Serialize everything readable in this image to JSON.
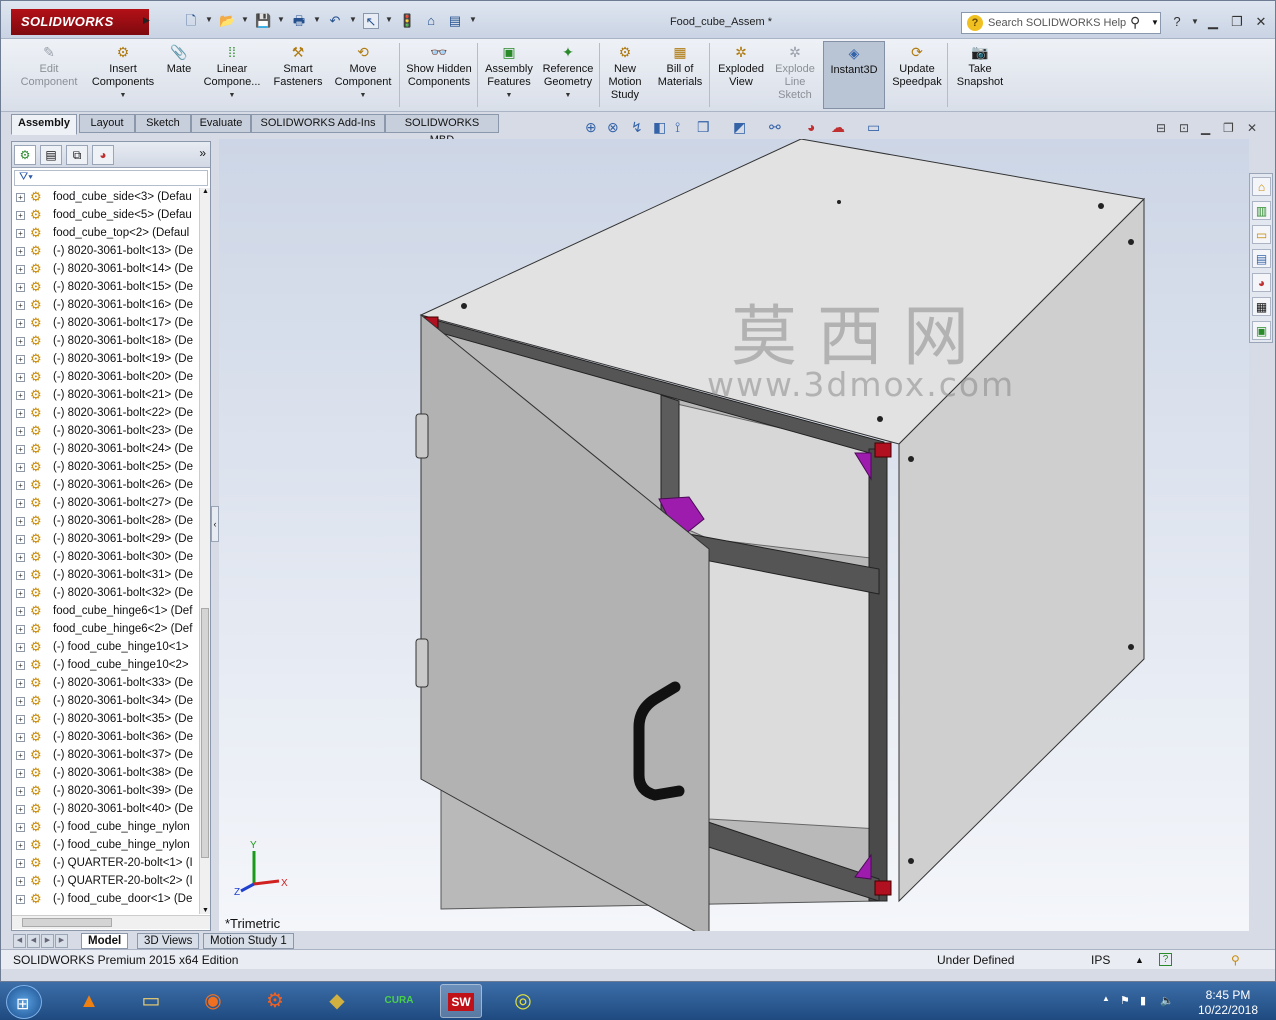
{
  "titlebar": {
    "app_logo": "SOLIDWORKS",
    "doc_title": "Food_cube_Assem *",
    "search_placeholder": "Search SOLIDWORKS Help",
    "quick_icons": [
      "new-icon",
      "open-icon",
      "save-icon",
      "print-icon",
      "undo-icon",
      "select-icon",
      "rebuild-icon",
      "options-icon"
    ],
    "window_icons": [
      "help-icon",
      "minimize-icon",
      "restore-icon",
      "close-icon"
    ]
  },
  "commands": [
    {
      "label": "Edit Component",
      "icon": "edit-component-icon",
      "disabled": true
    },
    {
      "label": "Insert Components",
      "icon": "insert-components-icon",
      "disabled": false
    },
    {
      "label": "Mate",
      "icon": "mate-icon",
      "disabled": false
    },
    {
      "label": "Linear Compone...",
      "icon": "linear-pattern-icon",
      "disabled": false
    },
    {
      "label": "Smart Fasteners",
      "icon": "smart-fasteners-icon",
      "disabled": false
    },
    {
      "label": "Move Component",
      "icon": "move-component-icon",
      "disabled": false
    },
    {
      "label": "Show Hidden Components",
      "icon": "show-hidden-icon",
      "disabled": false
    },
    {
      "label": "Assembly Features",
      "icon": "assembly-features-icon",
      "disabled": false
    },
    {
      "label": "Reference Geometry",
      "icon": "reference-geometry-icon",
      "disabled": false
    },
    {
      "label": "New Motion Study",
      "icon": "motion-study-icon",
      "disabled": false
    },
    {
      "label": "Bill of Materials",
      "icon": "bom-icon",
      "disabled": false
    },
    {
      "label": "Exploded View",
      "icon": "exploded-view-icon",
      "disabled": false
    },
    {
      "label": "Explode Line Sketch",
      "icon": "explode-line-icon",
      "disabled": true
    },
    {
      "label": "Instant3D",
      "icon": "instant3d-icon",
      "disabled": false
    },
    {
      "label": "Update Speedpak",
      "icon": "speedpak-icon",
      "disabled": false
    },
    {
      "label": "Take Snapshot",
      "icon": "snapshot-icon",
      "disabled": false
    }
  ],
  "cmd_tabs": [
    "Assembly",
    "Layout",
    "Sketch",
    "Evaluate",
    "SOLIDWORKS Add-Ins",
    "SOLIDWORKS MBD"
  ],
  "tree": [
    "food_cube_side<3> (Defau",
    "food_cube_side<5> (Defau",
    "food_cube_top<2> (Defaul",
    "(-) 8020-3061-bolt<13> (De",
    "(-) 8020-3061-bolt<14> (De",
    "(-) 8020-3061-bolt<15> (De",
    "(-) 8020-3061-bolt<16> (De",
    "(-) 8020-3061-bolt<17> (De",
    "(-) 8020-3061-bolt<18> (De",
    "(-) 8020-3061-bolt<19> (De",
    "(-) 8020-3061-bolt<20> (De",
    "(-) 8020-3061-bolt<21> (De",
    "(-) 8020-3061-bolt<22> (De",
    "(-) 8020-3061-bolt<23> (De",
    "(-) 8020-3061-bolt<24> (De",
    "(-) 8020-3061-bolt<25> (De",
    "(-) 8020-3061-bolt<26> (De",
    "(-) 8020-3061-bolt<27> (De",
    "(-) 8020-3061-bolt<28> (De",
    "(-) 8020-3061-bolt<29> (De",
    "(-) 8020-3061-bolt<30> (De",
    "(-) 8020-3061-bolt<31> (De",
    "(-) 8020-3061-bolt<32> (De",
    "food_cube_hinge6<1> (Def",
    "food_cube_hinge6<2> (Def",
    "(-) food_cube_hinge10<1>",
    "(-) food_cube_hinge10<2>",
    "(-) 8020-3061-bolt<33> (De",
    "(-) 8020-3061-bolt<34> (De",
    "(-) 8020-3061-bolt<35> (De",
    "(-) 8020-3061-bolt<36> (De",
    "(-) 8020-3061-bolt<37> (De",
    "(-) 8020-3061-bolt<38> (De",
    "(-) 8020-3061-bolt<39> (De",
    "(-) 8020-3061-bolt<40> (De",
    "(-) food_cube_hinge_nylon",
    "(-) food_cube_hinge_nylon",
    "(-) QUARTER-20-bolt<1> (I",
    "(-) QUARTER-20-bolt<2> (I",
    "(-) food_cube_door<1> (De"
  ],
  "viewport": {
    "watermark_cn": "莫西网",
    "watermark_url": "www.3dmox.com",
    "view_label": "*Trimetric",
    "triad": {
      "x": "X",
      "y": "Y",
      "z": "Z"
    }
  },
  "bottom_tabs": [
    "Model",
    "3D Views",
    "Motion Study 1"
  ],
  "status": {
    "edition": "SOLIDWORKS Premium 2015 x64 Edition",
    "state": "Under Defined",
    "units": "IPS"
  },
  "taskbar": {
    "apps": [
      "vlc-icon",
      "explorer-icon",
      "firefox-icon",
      "fusion-icon",
      "solid-app-icon",
      "cura-icon",
      "solidworks-2015-icon",
      "chrome-icon"
    ],
    "app_labels": {
      "cura": "CURA",
      "sw": "SW"
    },
    "time": "8:45 PM",
    "date": "10/22/2018"
  }
}
